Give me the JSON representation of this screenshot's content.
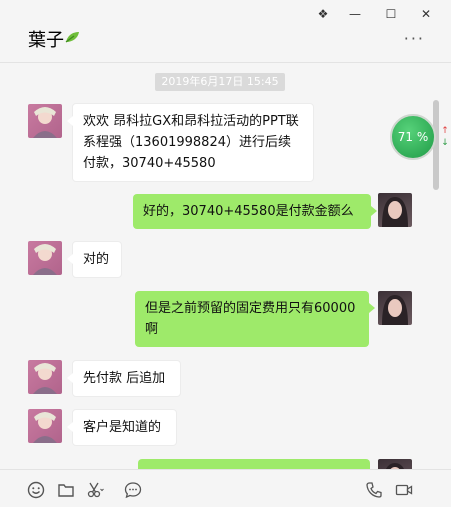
{
  "window": {
    "pin_glyph": "❖",
    "minimize_glyph": "—",
    "maximize_glyph": "☐",
    "close_glyph": "✕"
  },
  "header": {
    "title": "葉子",
    "more_glyph": "···"
  },
  "chat": {
    "timestamp": "2019年6月17日 15:45",
    "messages": [
      {
        "side": "in",
        "text": "欢欢 昂科拉GX和昂科拉活动的PPT联系程强（13601998824）进行后续付款，30740+45580"
      },
      {
        "side": "out",
        "text": "好的，30740+45580是付款金额么"
      },
      {
        "side": "in",
        "text": "对的"
      },
      {
        "side": "out",
        "text": "但是之前预留的固定费用只有60000啊"
      },
      {
        "side": "in",
        "text": "先付款 后追加"
      },
      {
        "side": "in",
        "text": "客户是知道的"
      },
      {
        "side": "out",
        "text": ""
      }
    ]
  },
  "overlay": {
    "percent_label": "71 %",
    "up_arrow": "↑",
    "down_arrow": "↓",
    "colors": {
      "badge": "#2fb35a",
      "up": "#e04040",
      "down": "#2e9b46"
    }
  },
  "toolbar": {
    "icons": [
      "emoji-icon",
      "folder-icon",
      "scissors-icon",
      "chat-bubble-icon",
      "phone-icon",
      "video-icon"
    ]
  },
  "colors": {
    "outgoing_bubble": "#9eea6a",
    "incoming_bubble": "#ffffff",
    "background": "#f5f5f5"
  }
}
